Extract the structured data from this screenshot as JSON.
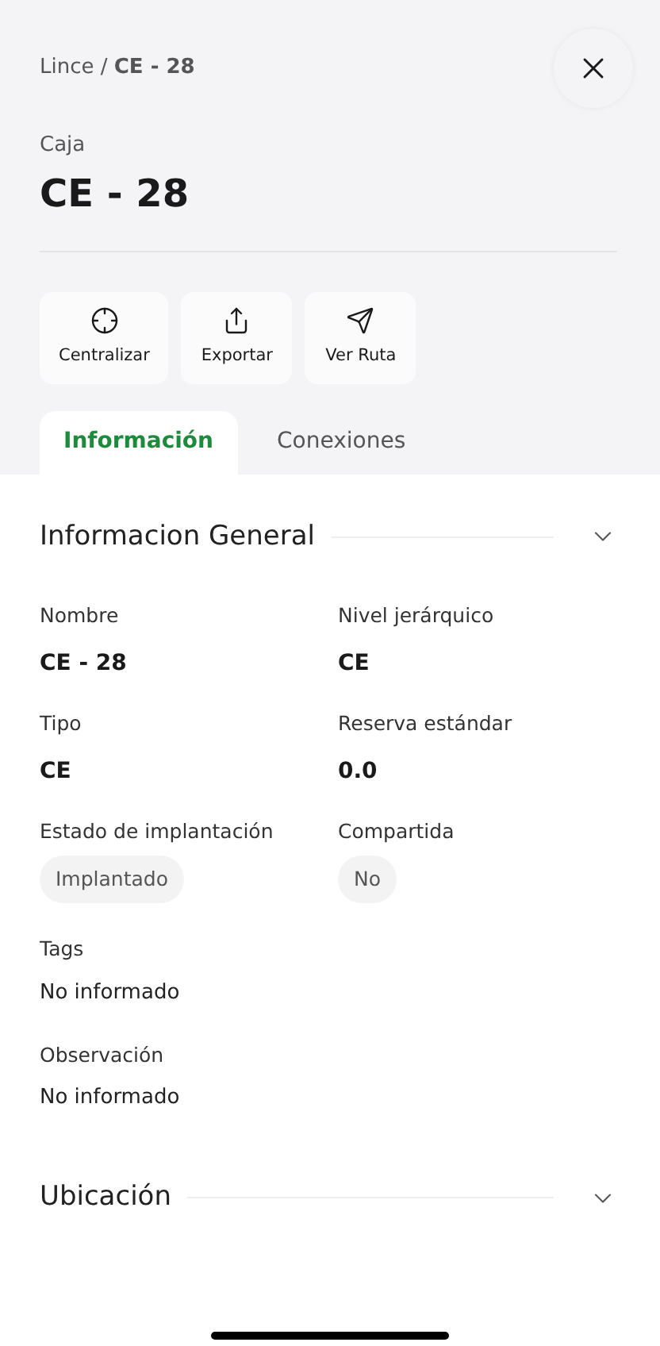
{
  "breadcrumb": "Lince / **CE - 28**",
  "header": {
    "subtitle": "Caja",
    "title": "CE - 28"
  },
  "actions": [
    {
      "kind": "crosshair",
      "label": "Centralizar"
    },
    {
      "kind": "share",
      "label": "Exportar"
    },
    {
      "kind": "send",
      "label": "Ver Ruta"
    }
  ],
  "tabs": [
    {
      "label": "Información",
      "selected": true
    },
    {
      "label": "Conexiones",
      "selected": false
    }
  ],
  "sections": [
    {
      "title": "Informacion General",
      "grid_fields": [
        {
          "label": "Nombre",
          "value": "CE - 28",
          "kind": "value"
        },
        {
          "label": "Nivel jerárquico",
          "value": "CE",
          "kind": "value"
        },
        {
          "label": "Tipo",
          "value": "CE",
          "kind": "value"
        },
        {
          "label": "Reserva estándar",
          "value": "0.0",
          "kind": "value"
        },
        {
          "label": "Estado de implantación",
          "value": "Implantado",
          "kind": "chip"
        },
        {
          "label": "Compartida",
          "value": "No",
          "kind": "chip"
        }
      ],
      "fields": [
        {
          "label": "Tags",
          "value": "No informado"
        },
        {
          "label": "Observación",
          "value": "No informado"
        }
      ]
    },
    {
      "title": "Ubicación"
    }
  ]
}
